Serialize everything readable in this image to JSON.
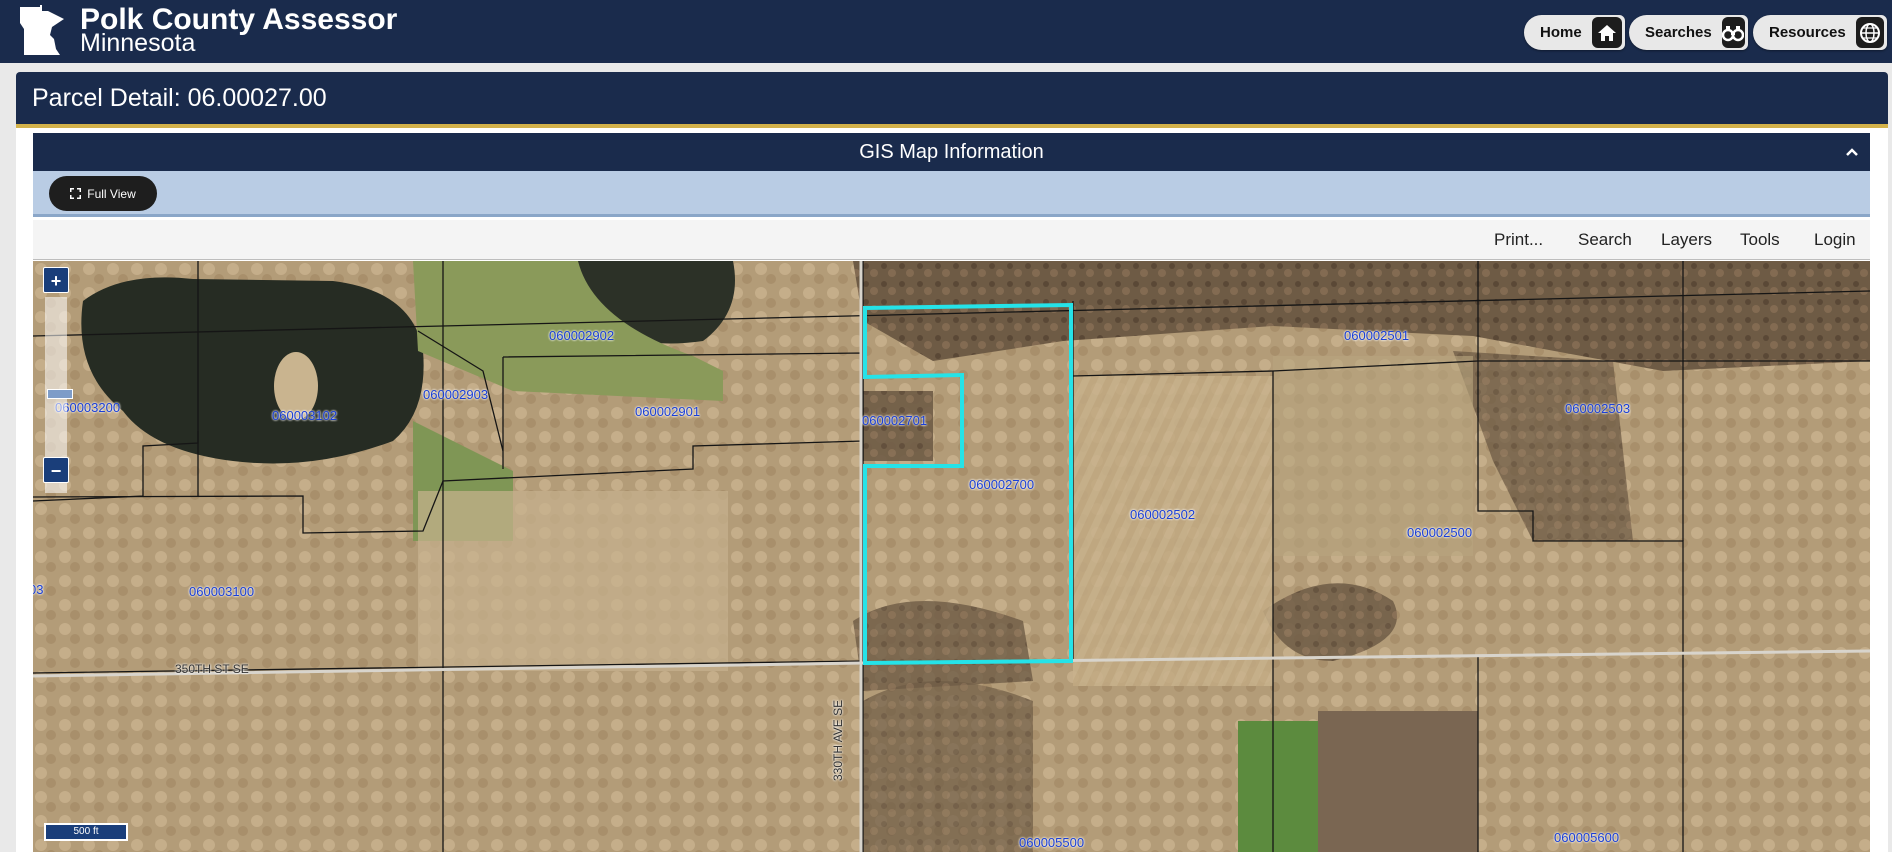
{
  "header": {
    "title": "Polk County Assessor",
    "subtitle": "Minnesota",
    "nav": [
      {
        "label": "Home",
        "icon": "home-icon"
      },
      {
        "label": "Searches",
        "icon": "binoculars-icon"
      },
      {
        "label": "Resources",
        "icon": "globe-icon"
      }
    ]
  },
  "parcel": {
    "title": "Parcel Detail: 06.00027.00"
  },
  "gis": {
    "title": "GIS Map Information",
    "full_view_label": "Full View",
    "menu": [
      "Print...",
      "Search",
      "Layers",
      "Tools",
      "Login"
    ]
  },
  "map": {
    "parcel_labels": [
      "060002902",
      "060003200",
      "060003102",
      "060002903",
      "060002901",
      "060002701",
      "060002700",
      "060002501",
      "060002503",
      "060002502",
      "060002500",
      "060003100",
      "03",
      "060005500",
      "060005600"
    ],
    "road_labels": [
      "350TH ST SE",
      "330TH AVE SE"
    ],
    "scale_label": "500 ft",
    "zoom_in": "+",
    "zoom_out": "−",
    "highlight_color": "#25e3e8",
    "label_color": "#1a3fd6"
  }
}
